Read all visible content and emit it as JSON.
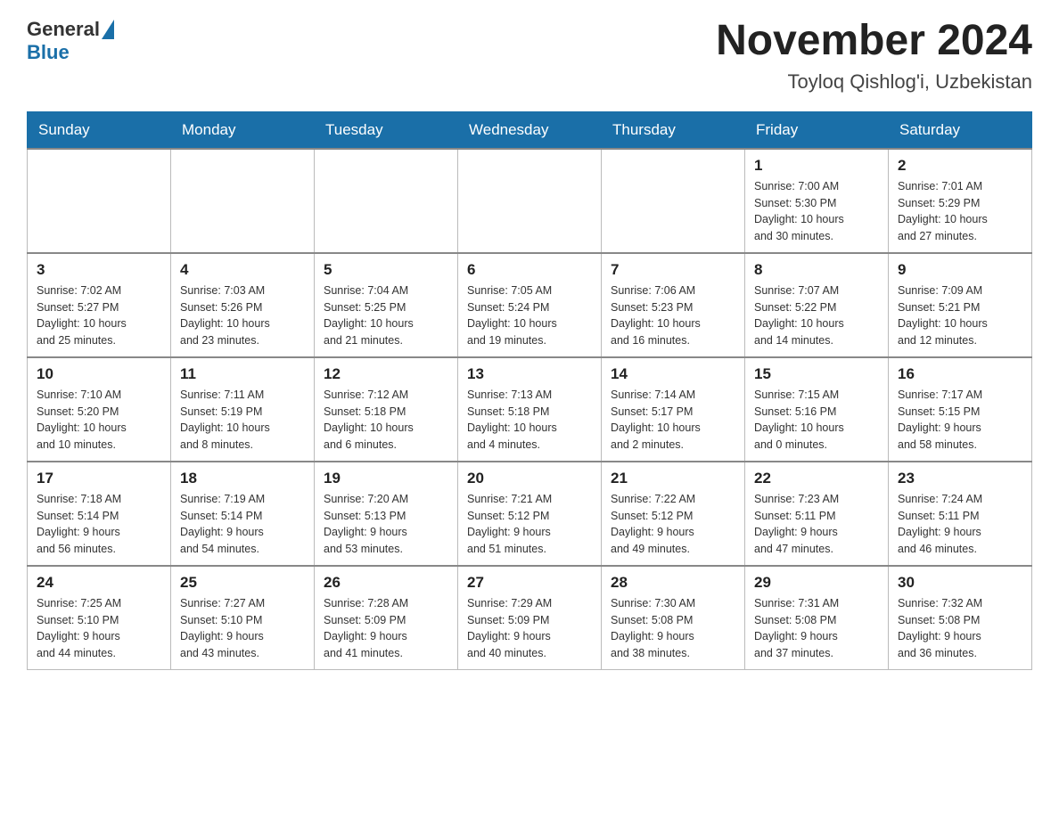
{
  "logo": {
    "general": "General",
    "blue": "Blue"
  },
  "header": {
    "month_year": "November 2024",
    "location": "Toyloq Qishlog'i, Uzbekistan"
  },
  "days_of_week": [
    "Sunday",
    "Monday",
    "Tuesday",
    "Wednesday",
    "Thursday",
    "Friday",
    "Saturday"
  ],
  "weeks": [
    [
      {
        "day": "",
        "info": ""
      },
      {
        "day": "",
        "info": ""
      },
      {
        "day": "",
        "info": ""
      },
      {
        "day": "",
        "info": ""
      },
      {
        "day": "",
        "info": ""
      },
      {
        "day": "1",
        "info": "Sunrise: 7:00 AM\nSunset: 5:30 PM\nDaylight: 10 hours\nand 30 minutes."
      },
      {
        "day": "2",
        "info": "Sunrise: 7:01 AM\nSunset: 5:29 PM\nDaylight: 10 hours\nand 27 minutes."
      }
    ],
    [
      {
        "day": "3",
        "info": "Sunrise: 7:02 AM\nSunset: 5:27 PM\nDaylight: 10 hours\nand 25 minutes."
      },
      {
        "day": "4",
        "info": "Sunrise: 7:03 AM\nSunset: 5:26 PM\nDaylight: 10 hours\nand 23 minutes."
      },
      {
        "day": "5",
        "info": "Sunrise: 7:04 AM\nSunset: 5:25 PM\nDaylight: 10 hours\nand 21 minutes."
      },
      {
        "day": "6",
        "info": "Sunrise: 7:05 AM\nSunset: 5:24 PM\nDaylight: 10 hours\nand 19 minutes."
      },
      {
        "day": "7",
        "info": "Sunrise: 7:06 AM\nSunset: 5:23 PM\nDaylight: 10 hours\nand 16 minutes."
      },
      {
        "day": "8",
        "info": "Sunrise: 7:07 AM\nSunset: 5:22 PM\nDaylight: 10 hours\nand 14 minutes."
      },
      {
        "day": "9",
        "info": "Sunrise: 7:09 AM\nSunset: 5:21 PM\nDaylight: 10 hours\nand 12 minutes."
      }
    ],
    [
      {
        "day": "10",
        "info": "Sunrise: 7:10 AM\nSunset: 5:20 PM\nDaylight: 10 hours\nand 10 minutes."
      },
      {
        "day": "11",
        "info": "Sunrise: 7:11 AM\nSunset: 5:19 PM\nDaylight: 10 hours\nand 8 minutes."
      },
      {
        "day": "12",
        "info": "Sunrise: 7:12 AM\nSunset: 5:18 PM\nDaylight: 10 hours\nand 6 minutes."
      },
      {
        "day": "13",
        "info": "Sunrise: 7:13 AM\nSunset: 5:18 PM\nDaylight: 10 hours\nand 4 minutes."
      },
      {
        "day": "14",
        "info": "Sunrise: 7:14 AM\nSunset: 5:17 PM\nDaylight: 10 hours\nand 2 minutes."
      },
      {
        "day": "15",
        "info": "Sunrise: 7:15 AM\nSunset: 5:16 PM\nDaylight: 10 hours\nand 0 minutes."
      },
      {
        "day": "16",
        "info": "Sunrise: 7:17 AM\nSunset: 5:15 PM\nDaylight: 9 hours\nand 58 minutes."
      }
    ],
    [
      {
        "day": "17",
        "info": "Sunrise: 7:18 AM\nSunset: 5:14 PM\nDaylight: 9 hours\nand 56 minutes."
      },
      {
        "day": "18",
        "info": "Sunrise: 7:19 AM\nSunset: 5:14 PM\nDaylight: 9 hours\nand 54 minutes."
      },
      {
        "day": "19",
        "info": "Sunrise: 7:20 AM\nSunset: 5:13 PM\nDaylight: 9 hours\nand 53 minutes."
      },
      {
        "day": "20",
        "info": "Sunrise: 7:21 AM\nSunset: 5:12 PM\nDaylight: 9 hours\nand 51 minutes."
      },
      {
        "day": "21",
        "info": "Sunrise: 7:22 AM\nSunset: 5:12 PM\nDaylight: 9 hours\nand 49 minutes."
      },
      {
        "day": "22",
        "info": "Sunrise: 7:23 AM\nSunset: 5:11 PM\nDaylight: 9 hours\nand 47 minutes."
      },
      {
        "day": "23",
        "info": "Sunrise: 7:24 AM\nSunset: 5:11 PM\nDaylight: 9 hours\nand 46 minutes."
      }
    ],
    [
      {
        "day": "24",
        "info": "Sunrise: 7:25 AM\nSunset: 5:10 PM\nDaylight: 9 hours\nand 44 minutes."
      },
      {
        "day": "25",
        "info": "Sunrise: 7:27 AM\nSunset: 5:10 PM\nDaylight: 9 hours\nand 43 minutes."
      },
      {
        "day": "26",
        "info": "Sunrise: 7:28 AM\nSunset: 5:09 PM\nDaylight: 9 hours\nand 41 minutes."
      },
      {
        "day": "27",
        "info": "Sunrise: 7:29 AM\nSunset: 5:09 PM\nDaylight: 9 hours\nand 40 minutes."
      },
      {
        "day": "28",
        "info": "Sunrise: 7:30 AM\nSunset: 5:08 PM\nDaylight: 9 hours\nand 38 minutes."
      },
      {
        "day": "29",
        "info": "Sunrise: 7:31 AM\nSunset: 5:08 PM\nDaylight: 9 hours\nand 37 minutes."
      },
      {
        "day": "30",
        "info": "Sunrise: 7:32 AM\nSunset: 5:08 PM\nDaylight: 9 hours\nand 36 minutes."
      }
    ]
  ]
}
